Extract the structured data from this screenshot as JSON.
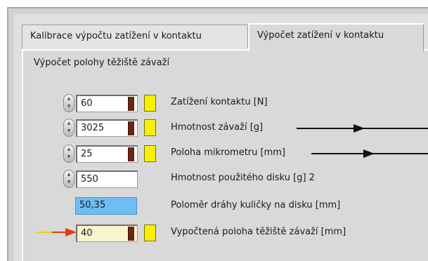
{
  "tabs": [
    {
      "label": "Kalibrace výpočtu zatížení v kontaktu",
      "active": false
    },
    {
      "label": "Výpočet zatížení v kontaktu",
      "active": true
    }
  ],
  "section_title": "Výpočet polohy těžiště závaží",
  "rows": [
    {
      "value": "60",
      "label": "Zatížení kontaktu [N]"
    },
    {
      "value": "3025",
      "label": "Hmotnost závaží [g]"
    },
    {
      "value": "25",
      "label": "Poloha mikrometru [mm]"
    },
    {
      "value": "550",
      "label": "Hmotnost použitého disku [g] 2"
    },
    {
      "value": "50,35",
      "label": "Poloměr dráhy kuličky na disku [mm]"
    },
    {
      "value": "40",
      "label": "Vypočtená poloha těžiště závaží [mm]"
    }
  ],
  "colors": {
    "readonly_field": "#6fbef3",
    "result_field": "#fbf3cc",
    "indicator_led": "#f7f000",
    "slider_mark": "#6a2610",
    "input_wire": "#e53a10"
  },
  "icons": {
    "stepper": "up-down-arrows",
    "wire_arrow": "right-arrow"
  }
}
